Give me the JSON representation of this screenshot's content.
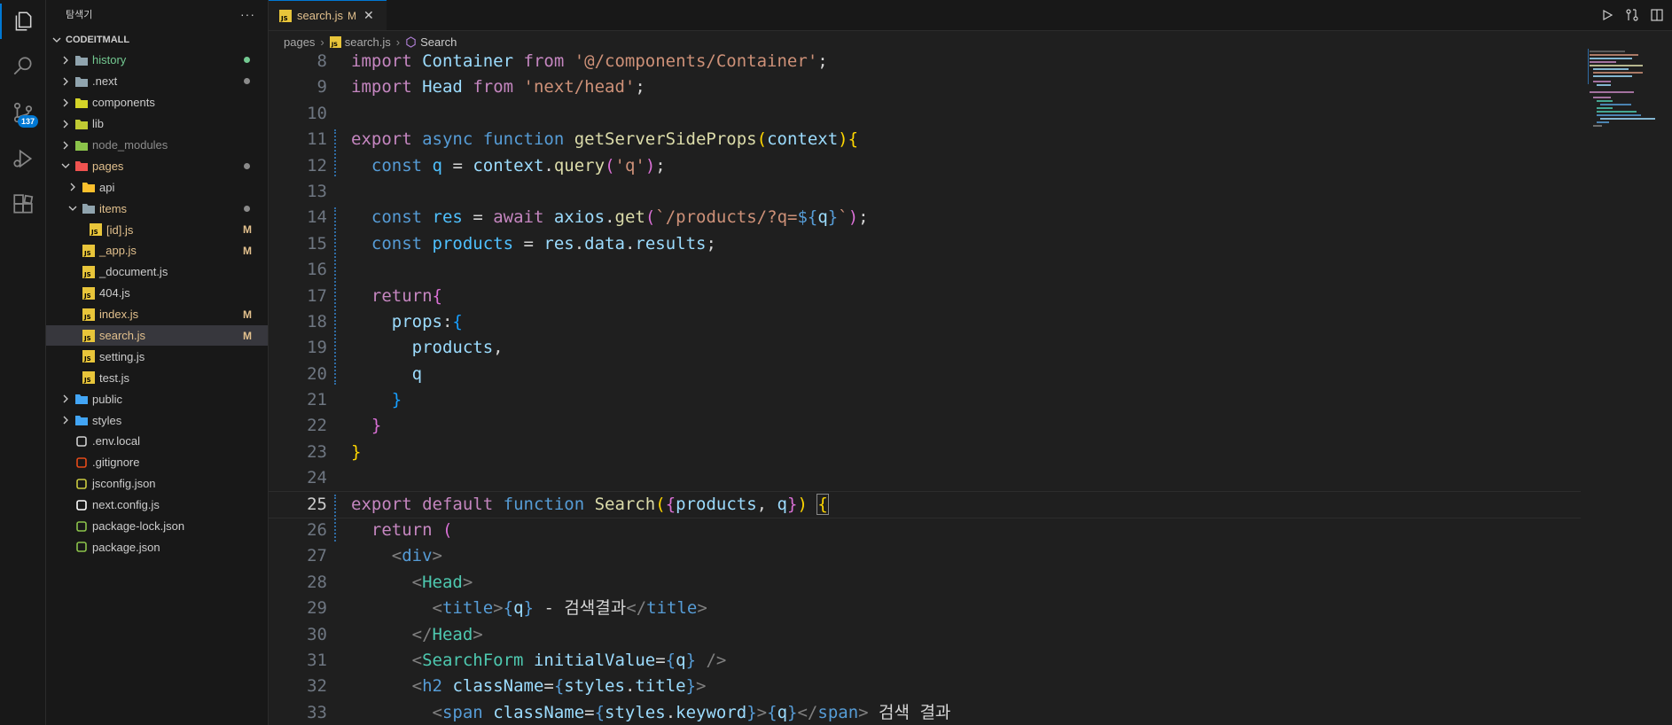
{
  "sidebar": {
    "title": "탐색기",
    "more": "···",
    "section": "CODEITMALL",
    "items": [
      {
        "label": "history",
        "status": "dot",
        "color": "#73c991",
        "depth": 0,
        "type": "folder"
      },
      {
        "label": ".next",
        "status": "dot",
        "color": "#8a8a8a",
        "depth": 0,
        "type": "folder"
      },
      {
        "label": "components",
        "status": "",
        "color": "",
        "depth": 0,
        "type": "folder"
      },
      {
        "label": "lib",
        "status": "",
        "color": "",
        "depth": 0,
        "type": "folder"
      },
      {
        "label": "node_modules",
        "status": "",
        "color": "",
        "depth": 0,
        "type": "folder"
      },
      {
        "label": "pages",
        "status": "dot",
        "color": "#8a8a8a",
        "depth": 0,
        "type": "folder-open"
      },
      {
        "label": "api",
        "status": "",
        "color": "",
        "depth": 1,
        "type": "folder"
      },
      {
        "label": "items",
        "status": "dot",
        "color": "#8a8a8a",
        "depth": 1,
        "type": "folder-open"
      },
      {
        "label": "[id].js",
        "status": "M",
        "color": "#e2c08d",
        "depth": 2,
        "type": "file"
      },
      {
        "label": "_app.js",
        "status": "M",
        "color": "#e2c08d",
        "depth": 1,
        "type": "file"
      },
      {
        "label": "_document.js",
        "status": "",
        "color": "",
        "depth": 1,
        "type": "file"
      },
      {
        "label": "404.js",
        "status": "",
        "color": "",
        "depth": 1,
        "type": "file"
      },
      {
        "label": "index.js",
        "status": "M",
        "color": "#e2c08d",
        "depth": 1,
        "type": "file"
      },
      {
        "label": "search.js",
        "status": "M",
        "color": "#e2c08d",
        "depth": 1,
        "type": "file"
      },
      {
        "label": "setting.js",
        "status": "",
        "color": "",
        "depth": 1,
        "type": "file"
      },
      {
        "label": "test.js",
        "status": "",
        "color": "",
        "depth": 1,
        "type": "file"
      },
      {
        "label": "public",
        "status": "",
        "color": "",
        "depth": 0,
        "type": "folder"
      },
      {
        "label": "styles",
        "status": "",
        "color": "",
        "depth": 0,
        "type": "folder"
      },
      {
        "label": ".env.local",
        "status": "",
        "color": "",
        "depth": 0,
        "type": "file"
      },
      {
        "label": ".gitignore",
        "status": "",
        "color": "",
        "depth": 0,
        "type": "file"
      },
      {
        "label": "jsconfig.json",
        "status": "",
        "color": "",
        "depth": 0,
        "type": "file"
      },
      {
        "label": "next.config.js",
        "status": "",
        "color": "",
        "depth": 0,
        "type": "file"
      },
      {
        "label": "package-lock.json",
        "status": "",
        "color": "",
        "depth": 0,
        "type": "file"
      },
      {
        "label": "package.json",
        "status": "",
        "color": "",
        "depth": 0,
        "type": "file"
      }
    ]
  },
  "activity": {
    "scm_badge": "137"
  },
  "tab": {
    "label": "search.js",
    "modified": "M",
    "close": "✕"
  },
  "breadcrumb": {
    "a": "pages",
    "b": "search.js",
    "c": "Search"
  },
  "editor": {
    "lines": [
      {
        "n": "8",
        "h": "<span class='k'>import</span> <span class='v'>Container</span> <span class='k'>from</span> <span class='s'>'@/components/Container'</span>;"
      },
      {
        "n": "9",
        "h": "<span class='k'>import</span> <span class='v'>Head</span> <span class='k'>from</span> <span class='s'>'next/head'</span>;"
      },
      {
        "n": "10",
        "h": ""
      },
      {
        "n": "11",
        "h": "<span class='k'>export</span> <span class='kb'>async</span> <span class='kb'>function</span> <span class='f'>getServerSideProps</span><span class='br1'>(</span><span class='v'>context</span><span class='br1'>){</span>"
      },
      {
        "n": "12",
        "h": "  <span class='kb'>const</span> <span class='c'>q</span> = <span class='v'>context</span>.<span class='f'>query</span><span class='br2'>(</span><span class='s'>'q'</span><span class='br2'>)</span>;"
      },
      {
        "n": "13",
        "h": ""
      },
      {
        "n": "14",
        "h": "  <span class='kb'>const</span> <span class='c'>res</span> = <span class='k'>await</span> <span class='v'>axios</span>.<span class='f'>get</span><span class='br2'>(</span><span class='s'>`/products/?q=</span><span class='kb'>${</span><span class='v'>q</span><span class='kb'>}</span><span class='s'>`</span><span class='br2'>)</span>;"
      },
      {
        "n": "15",
        "h": "  <span class='kb'>const</span> <span class='c'>products</span> = <span class='v'>res</span>.<span class='v'>data</span>.<span class='v'>results</span>;"
      },
      {
        "n": "16",
        "h": ""
      },
      {
        "n": "17",
        "h": "  <span class='k'>return</span><span class='br2'>{</span>"
      },
      {
        "n": "18",
        "h": "    <span class='v'>props</span>:<span class='br3'>{</span>"
      },
      {
        "n": "19",
        "h": "      <span class='v'>products</span>,"
      },
      {
        "n": "20",
        "h": "      <span class='v'>q</span>"
      },
      {
        "n": "21",
        "h": "    <span class='br3'>}</span>"
      },
      {
        "n": "22",
        "h": "  <span class='br2'>}</span>"
      },
      {
        "n": "23",
        "h": "<span class='br1'>}</span>"
      },
      {
        "n": "24",
        "h": ""
      },
      {
        "n": "25",
        "h": "<span class='k'>export</span> <span class='k'>default</span> <span class='kb'>function</span> <span class='f'>Search</span><span class='br1'>(</span><span class='br2'>{</span><span class='v'>products</span>, <span class='v'>q</span><span class='br2'>}</span><span class='br1'>)</span> <span class='br1' style='outline:1px solid #888'>{</span>"
      },
      {
        "n": "26",
        "h": "  <span class='k'>return</span> <span class='br2'>(</span>"
      },
      {
        "n": "27",
        "h": "    <span class='p'>&lt;</span><span class='tgh'>div</span><span class='p'>&gt;</span>"
      },
      {
        "n": "28",
        "h": "      <span class='p'>&lt;</span><span class='tg'>Head</span><span class='p'>&gt;</span>"
      },
      {
        "n": "29",
        "h": "        <span class='p'>&lt;</span><span class='tgh'>title</span><span class='p'>&gt;</span><span class='kb'>{</span><span class='v'>q</span><span class='kb'>}</span> <span class='w'>- 검색결과</span><span class='p'>&lt;/</span><span class='tgh'>title</span><span class='p'>&gt;</span>"
      },
      {
        "n": "30",
        "h": "      <span class='p'>&lt;/</span><span class='tg'>Head</span><span class='p'>&gt;</span>"
      },
      {
        "n": "31",
        "h": "      <span class='p'>&lt;</span><span class='tg'>SearchForm</span> <span class='v'>initialValue</span>=<span class='kb'>{</span><span class='v'>q</span><span class='kb'>}</span> <span class='p'>/&gt;</span>"
      },
      {
        "n": "32",
        "h": "      <span class='p'>&lt;</span><span class='tgh'>h2</span> <span class='v'>className</span>=<span class='kb'>{</span><span class='v'>styles</span>.<span class='v'>title</span><span class='kb'>}</span><span class='p'>&gt;</span>"
      },
      {
        "n": "33",
        "h": "        <span class='p'>&lt;</span><span class='tgh'>span</span> <span class='v'>className</span>=<span class='kb'>{</span><span class='v'>styles</span>.<span class='v'>keyword</span><span class='kb'>}</span><span class='p'>&gt;</span><span class='kb'>{</span><span class='v'>q</span><span class='kb'>}</span><span class='p'>&lt;/</span><span class='tgh'>span</span><span class='p'>&gt;</span> <span class='w'>검색 결과</span>"
      }
    ],
    "current_line": "25"
  }
}
